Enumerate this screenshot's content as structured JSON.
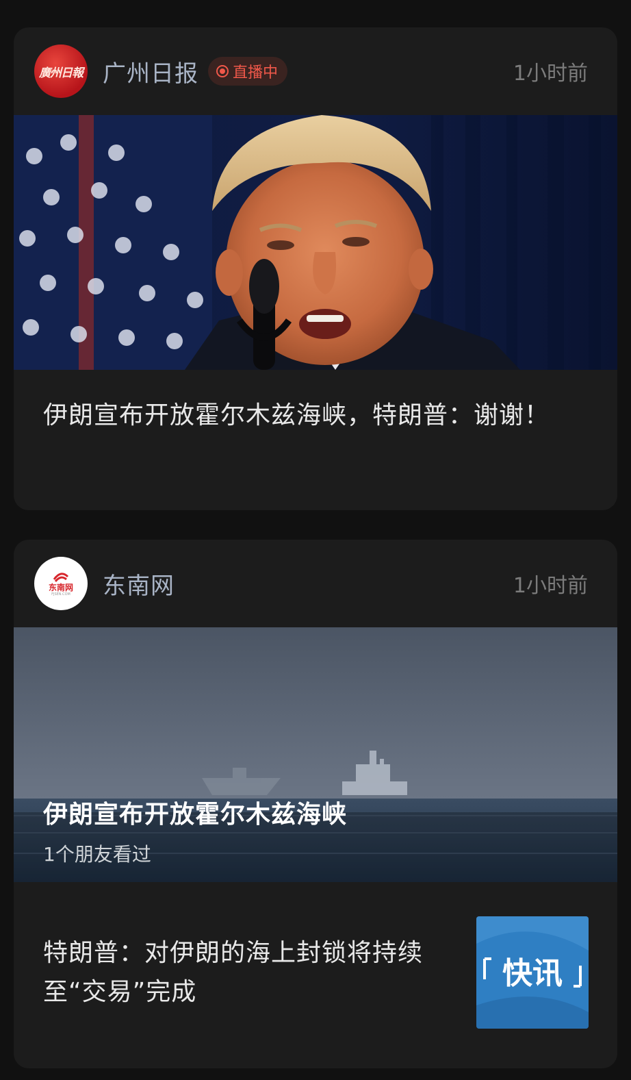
{
  "feed": {
    "cards": [
      {
        "source": "广州日报",
        "logo_text": "廣州日報",
        "live_label": "直播中",
        "time": "1小时前",
        "headline": "伊朗宣布开放霍尔木兹海峡，特朗普：谢谢！"
      },
      {
        "source": "东南网",
        "logo_text": "东南网",
        "logo_sub": "FJSEN.COM",
        "time": "1小时前",
        "video_title": "伊朗宣布开放霍尔木兹海峡",
        "video_subtitle": "1个朋友看过",
        "headline": "特朗普：对伊朗的海上封锁将持续至“交易”完成",
        "thumb_text": "快讯"
      }
    ]
  },
  "colors": {
    "background": "#111111",
    "card": "#1c1c1c",
    "live_accent": "#f0584a",
    "source_text": "#a9b4c6",
    "thumb_blue": "#2f7fc3"
  },
  "icons": [
    "guangzhou-daily-logo",
    "live-dot-icon",
    "dongnan-logo"
  ]
}
